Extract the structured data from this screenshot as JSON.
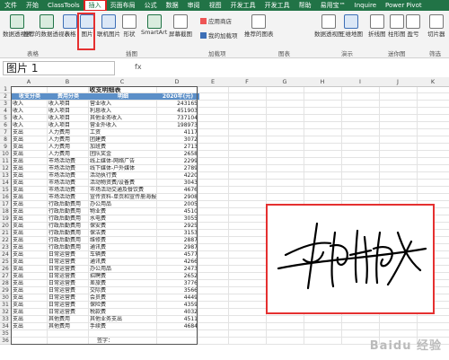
{
  "menu": [
    "文件",
    "开始",
    "ClassTools",
    "插入",
    "页面布局",
    "公式",
    "数据",
    "审阅",
    "视图",
    "开发工具",
    "开发工具",
    "帮助",
    "易用宝™",
    "Inquire",
    "Power Pivot"
  ],
  "ribbon": {
    "buttons": [
      "数据透视表",
      "推荐的数据透视表",
      "表格",
      "图片",
      "联机图片",
      "形状",
      "SmartArt",
      "屏幕截图",
      "应用商店",
      "我的加载项",
      "推荐的图表",
      "数据透视图",
      "三维地图",
      "折线图",
      "柱形图",
      "盈亏",
      "切片器"
    ],
    "groups": [
      "表格",
      "插图",
      "加载项",
      "图表",
      "演示",
      "迷你图",
      "筛选"
    ]
  },
  "formula_bar": {
    "name_box": "图片 1",
    "fx": "fx"
  },
  "columns": [
    "A",
    "B",
    "C",
    "D",
    "E",
    "F",
    "G",
    "H",
    "I",
    "J",
    "K"
  ],
  "table": {
    "title": "收支明细表",
    "headers": [
      "收支分类",
      "费用分类",
      "明细",
      "2020年(元)"
    ],
    "rows": [
      [
        "收入",
        "收入项目",
        "营业收入",
        "243165"
      ],
      [
        "收入",
        "收入项目",
        "利息收入",
        "451903"
      ],
      [
        "收入",
        "收入项目",
        "其他业务收入",
        "737104"
      ],
      [
        "收入",
        "收入项目",
        "营业外收入",
        "198973"
      ],
      [
        "支出",
        "人力费用",
        "工资",
        "4117"
      ],
      [
        "支出",
        "人力费用",
        "团建费",
        "3072"
      ],
      [
        "支出",
        "人力费用",
        "加班费",
        "2713"
      ],
      [
        "支出",
        "人力费用",
        "团队奖金",
        "2658"
      ],
      [
        "支出",
        "市场活动费",
        "线上媒体-网络广告",
        "2299"
      ],
      [
        "支出",
        "市场活动费",
        "线下媒体-户外媒体",
        "2789"
      ],
      [
        "支出",
        "市场活动费",
        "活动执行费",
        "4220"
      ],
      [
        "支出",
        "市场活动费",
        "活动物资费/设备费",
        "3043"
      ],
      [
        "支出",
        "市场活动费",
        "市场活动交通及餐饮费",
        "4676"
      ],
      [
        "支出",
        "市场活动费",
        "宣传资料-单页和宣传册海报",
        "2908"
      ],
      [
        "支出",
        "行政后勤费用",
        "办公用品",
        "2005"
      ],
      [
        "支出",
        "行政后勤费用",
        "物业费",
        "4510"
      ],
      [
        "支出",
        "行政后勤费用",
        "水电费",
        "3055"
      ],
      [
        "支出",
        "行政后勤费用",
        "保安费",
        "2925"
      ],
      [
        "支出",
        "行政后勤费用",
        "保洁费",
        "3153"
      ],
      [
        "支出",
        "行政后勤费用",
        "维修费",
        "2887"
      ],
      [
        "支出",
        "行政后勤费用",
        "通讯费",
        "2987"
      ],
      [
        "支出",
        "日常运营费",
        "车辆费",
        "4577"
      ],
      [
        "支出",
        "日常运营费",
        "通讯费",
        "4266"
      ],
      [
        "支出",
        "日常运营费",
        "办公用品",
        "2473"
      ],
      [
        "支出",
        "日常运营费",
        "招聘费",
        "2652"
      ],
      [
        "支出",
        "日常运营费",
        "差旅费",
        "3776"
      ],
      [
        "支出",
        "日常运营费",
        "交际费",
        "3566"
      ],
      [
        "支出",
        "日常运营费",
        "会员费",
        "4449"
      ],
      [
        "支出",
        "日常运营费",
        "保险费",
        "4359"
      ],
      [
        "支出",
        "日常运营费",
        "税款费",
        "4032"
      ],
      [
        "支出",
        "其他费用",
        "其他业务支出",
        "4511"
      ],
      [
        "支出",
        "其他费用",
        "手续费",
        "4684"
      ]
    ],
    "signature_label": "签字："
  },
  "watermark": "Baidu 经验"
}
